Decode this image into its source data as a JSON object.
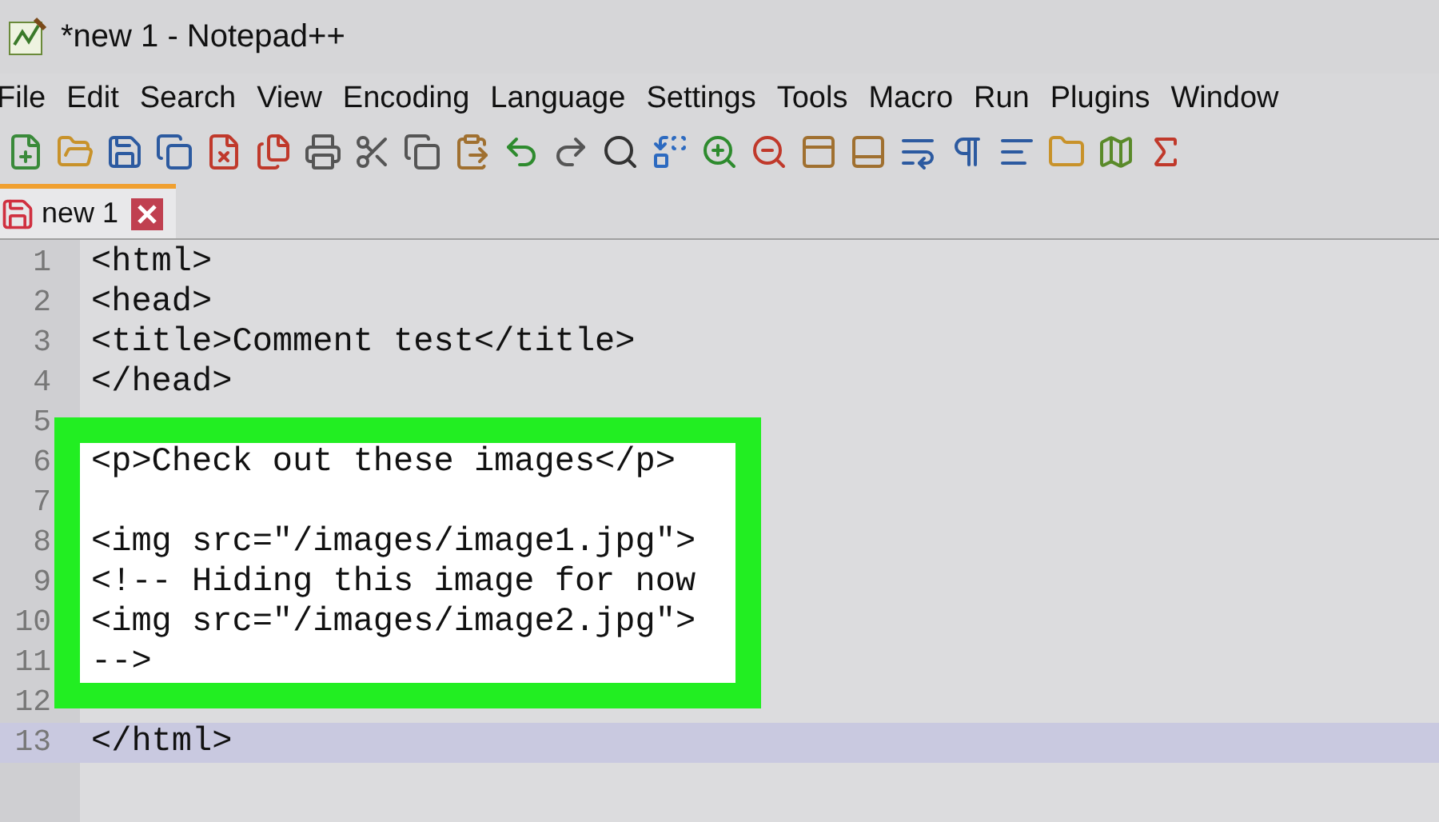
{
  "window": {
    "title": "*new 1 - Notepad++"
  },
  "menu": [
    "File",
    "Edit",
    "Search",
    "View",
    "Encoding",
    "Language",
    "Settings",
    "Tools",
    "Macro",
    "Run",
    "Plugins",
    "Window"
  ],
  "tabs": [
    {
      "label": "new 1",
      "selected": true,
      "modified": true
    }
  ],
  "editor": {
    "lines": [
      {
        "number": "1",
        "text": "<html>",
        "current": false,
        "highlighted": false
      },
      {
        "number": "2",
        "text": "<head>",
        "current": false,
        "highlighted": false
      },
      {
        "number": "3",
        "text": "<title>Comment test</title>",
        "current": false,
        "highlighted": false
      },
      {
        "number": "4",
        "text": "</head>",
        "current": false,
        "highlighted": false
      },
      {
        "number": "5",
        "current": false,
        "highlighted": false
      },
      {
        "number": "6",
        "text": "<p>Check out these images</p>",
        "current": false,
        "highlighted": true
      },
      {
        "number": "7",
        "current": false,
        "highlighted": true
      },
      {
        "number": "8",
        "text": "<img src=\"/images/image1.jpg\">",
        "current": false,
        "highlighted": true
      },
      {
        "number": "9",
        "text": "<!-- Hiding this image for now",
        "current": false,
        "highlighted": true
      },
      {
        "number": "10",
        "text": "<img src=\"/images/image2.jpg\">",
        "current": false,
        "highlighted": true
      },
      {
        "number": "11",
        "text": "-->",
        "current": false,
        "highlighted": true
      },
      {
        "number": "12",
        "current": false,
        "highlighted": false
      },
      {
        "number": "13",
        "text": "</html>",
        "current": true,
        "highlighted": false
      }
    ]
  }
}
